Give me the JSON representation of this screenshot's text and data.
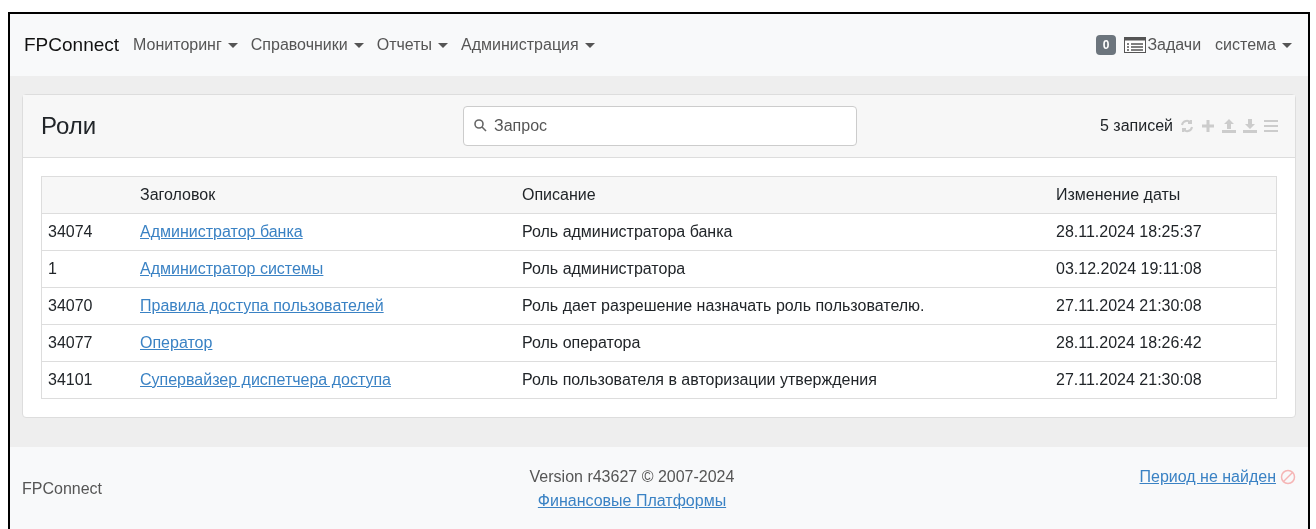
{
  "navbar": {
    "brand": "FPConnect",
    "menus": [
      {
        "label": "Мониторинг"
      },
      {
        "label": "Справочники"
      },
      {
        "label": "Отчеты"
      },
      {
        "label": "Администрация"
      }
    ],
    "tasks_count": "0",
    "tasks_label": "Задачи",
    "user": "система"
  },
  "panel": {
    "title": "Роли",
    "search": {
      "placeholder": "Запрос"
    },
    "record_count": "5 записей"
  },
  "table": {
    "columns": [
      "",
      "Заголовок",
      "Описание",
      "Изменение даты"
    ],
    "rows": [
      {
        "id": "34074",
        "title": "Администратор банка",
        "description": "Роль администратора банка",
        "modified": "28.11.2024 18:25:37"
      },
      {
        "id": "1",
        "title": "Администратор системы",
        "description": "Роль администратора",
        "modified": "03.12.2024 19:11:08"
      },
      {
        "id": "34070",
        "title": "Правила доступа пользователей",
        "description": "Роль дает разрешение назначать роль пользователю.",
        "modified": "27.11.2024 21:30:08"
      },
      {
        "id": "34077",
        "title": "Оператор",
        "description": "Роль оператора",
        "modified": "28.11.2024 18:26:42"
      },
      {
        "id": "34101",
        "title": "Супервайзер диспетчера доступа",
        "description": "Роль пользователя в авторизации утверждения",
        "modified": "27.11.2024 21:30:08"
      }
    ]
  },
  "footer": {
    "brand": "FPConnect",
    "version": "Version r43627 © 2007-2024",
    "company_link": "Финансовые Платформы",
    "period_link": "Период не найден"
  }
}
